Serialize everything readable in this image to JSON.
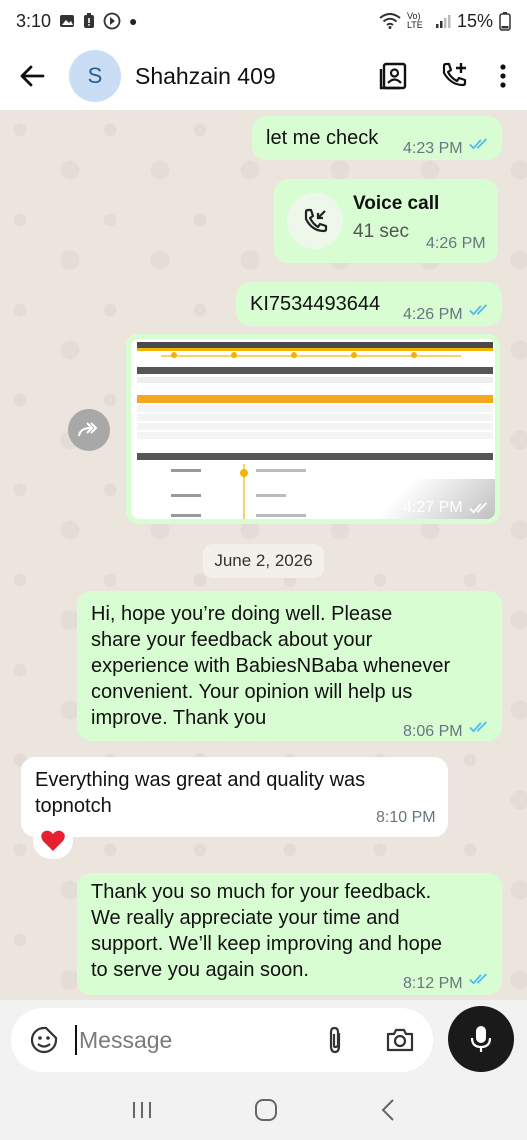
{
  "status_bar": {
    "time": "3:10",
    "battery": "15%",
    "network": "Vo) LTE"
  },
  "header": {
    "avatar_letter": "S",
    "contact_name": "Shahzain 409"
  },
  "messages": {
    "m1": {
      "text": "let me check",
      "time": "4:23 PM"
    },
    "call": {
      "title": "Voice call",
      "duration": "41 sec",
      "time": "4:26 PM"
    },
    "m2": {
      "text": "KI7534493644",
      "time": "4:26 PM"
    },
    "image": {
      "time": "4:27 PM"
    },
    "date_chip": "June 2, 2026",
    "m3": {
      "lines": [
        "Hi, hope you’re doing well. Please",
        "share your feedback about your",
        "experience with BabiesNBaba whenever",
        "convenient. Your opinion will help us",
        "improve. Thank you"
      ],
      "time": "8:06 PM"
    },
    "m4": {
      "lines": [
        "Everything was great and quality was",
        "topnotch"
      ],
      "time": "8:10 PM",
      "reaction": "❤️"
    },
    "m5": {
      "lines": [
        "Thank you so much for your feedback.",
        "We really appreciate your time and",
        "support. We’ll keep improving and hope",
        "to serve you again soon."
      ],
      "time": "8:12 PM"
    }
  },
  "input": {
    "placeholder": "Message"
  },
  "colors": {
    "outgoing": "#d9fdd3",
    "incoming": "#ffffff",
    "tick_blue": "#53bdeb",
    "chat_bg": "#ece5dd"
  }
}
